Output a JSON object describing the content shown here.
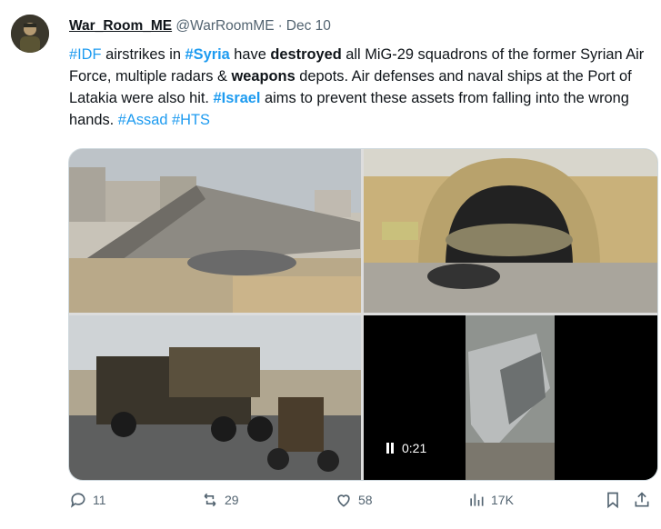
{
  "tweet": {
    "author_name": "War_Room_ME",
    "author_handle": "@WarRoomME",
    "separator": "·",
    "date": "Dec 10",
    "text": {
      "t1": "#IDF",
      "t2": " airstrikes in ",
      "t3": "#Syria",
      "t4": " have ",
      "t5": "destroyed",
      "t6": " all MiG-29 squadrons of the former Syrian Air Force, multiple radars & ",
      "t7": "weapons",
      "t8": " depots. Air defenses and naval ships at the Port of Latakia were also hit. ",
      "t9": "#Israel",
      "t10": " aims to prevent these assets from falling into the wrong hands. ",
      "t11": "#Assad",
      "t12": " ",
      "t13": "#HTS"
    },
    "video_duration": "0:21"
  },
  "actions": {
    "replies": "11",
    "reposts": "29",
    "likes": "58",
    "views": "17K"
  },
  "colors": {
    "link": "#1d9bf0",
    "muted": "#536471",
    "text": "#0f1419"
  }
}
